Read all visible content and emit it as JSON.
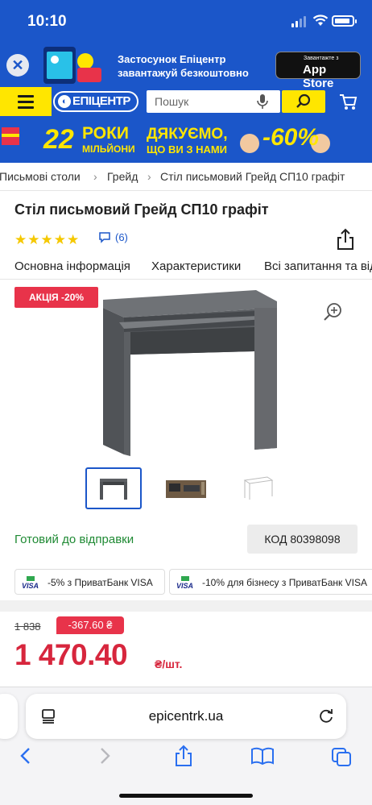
{
  "status_bar": {
    "time": "10:10"
  },
  "app_banner": {
    "line1": "Застосунок Епіцентр",
    "line2": "завантажуй безкоштовно",
    "store_small": "Завантажте з",
    "store_big": "App Store"
  },
  "header": {
    "logo": "ЕПІЦЕНТР",
    "search_placeholder": "Пошук"
  },
  "promo": {
    "number": "22",
    "years": "РОКИ",
    "millions": "МІЛЬЙОНИ",
    "thanks_line1": "ДЯКУЄМО,",
    "thanks_line2": "ЩО ВИ З НАМИ",
    "discount": "-60%"
  },
  "breadcrumb": [
    "Письмові столи",
    "Грейд",
    "Стіл письмовий Грейд СП10 графіт"
  ],
  "product": {
    "title": "Стіл письмовий Грейд СП10 графіт",
    "rating": 5,
    "reviews": "(6)",
    "sale_badge": "АКЦІЯ -20%",
    "availability": "Готовий до відправки",
    "code": "КОД 80398098"
  },
  "tabs": [
    "Основна інформація",
    "Характеристики",
    "Всі запитання та відповіді"
  ],
  "offers": [
    {
      "text": "-5% з ПриватБанк VISA"
    },
    {
      "text": "-10% для бізнесу з ПриватБанк VISA"
    }
  ],
  "pricing": {
    "old_price": "1 838",
    "saving": "-367.60 ₴",
    "price": "1 470.40",
    "unit": "₴/шт."
  },
  "browser": {
    "url": "epicentrk.ua"
  },
  "colors": {
    "brand_blue": "#1b56c9",
    "brand_yellow": "#ffe600",
    "sale_red": "#e8334a",
    "ready_green": "#1f8a34"
  }
}
